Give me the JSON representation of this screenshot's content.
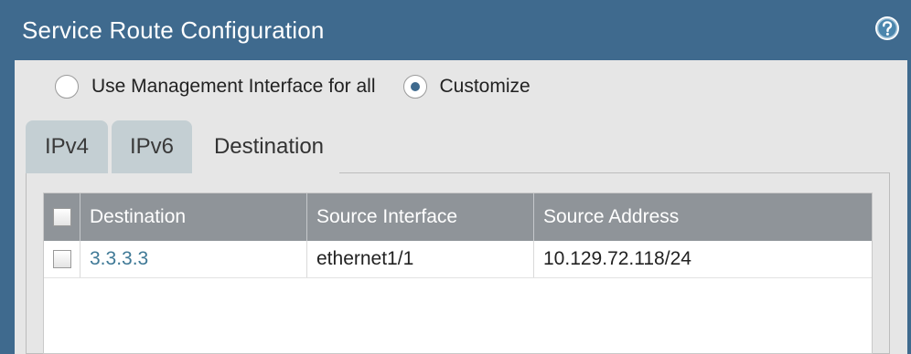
{
  "dialog": {
    "title": "Service Route Configuration",
    "help_icon": "help-circle-icon"
  },
  "radio_options": [
    {
      "label": "Use Management Interface for all",
      "selected": false
    },
    {
      "label": "Customize",
      "selected": true
    }
  ],
  "tabs": [
    {
      "label": "IPv4",
      "active": false
    },
    {
      "label": "IPv6",
      "active": false
    },
    {
      "label": "Destination",
      "active": true
    }
  ],
  "table": {
    "columns": [
      "Destination",
      "Source Interface",
      "Source Address"
    ],
    "rows": [
      {
        "destination": "3.3.3.3",
        "source_interface": "ethernet1/1",
        "source_address": "10.129.72.118/24"
      }
    ]
  },
  "colors": {
    "title_bar": "#3f6a8e",
    "tab_inactive": "#c4cfd3",
    "header_bg": "#8f9499",
    "link": "#3f7996"
  }
}
